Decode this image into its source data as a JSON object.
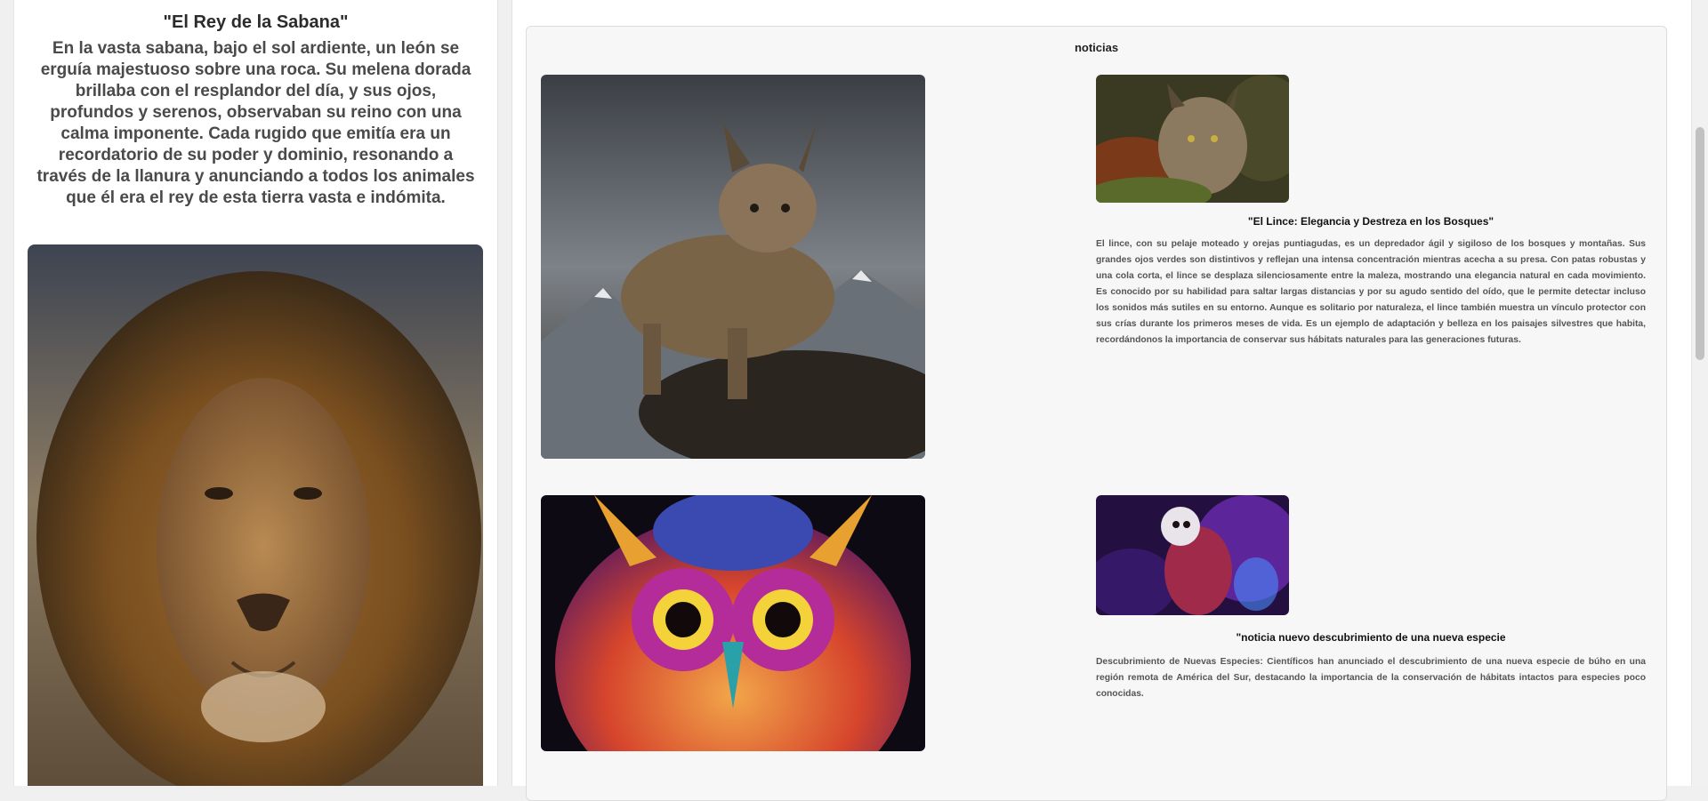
{
  "story": {
    "title": "\"El Rey de la Sabana\"",
    "body": "En la vasta sabana, bajo el sol ardiente, un león se erguía majestuoso sobre una roca. Su melena dorada brillaba con el resplandor del día, y sus ojos, profundos y serenos, observaban su reino con una calma imponente. Cada rugido que emitía era un recordatorio de su poder y dominio, resonando a través de la llanura y anunciando a todos los animales que él era el rey de esta tierra vasta e indómita."
  },
  "news": {
    "heading": "noticias",
    "articles": [
      {
        "title": "\"El Lince: Elegancia y Destreza en los Bosques\"",
        "body": "El lince, con su pelaje moteado y orejas puntiagudas, es un depredador ágil y sigiloso de los bosques y montañas. Sus grandes ojos verdes son distintivos y reflejan una intensa concentración mientras acecha a su presa. Con patas robustas y una cola corta, el lince se desplaza silenciosamente entre la maleza, mostrando una elegancia natural en cada movimiento. Es conocido por su habilidad para saltar largas distancias y por su agudo sentido del oído, que le permite detectar incluso los sonidos más sutiles en su entorno. Aunque es solitario por naturaleza, el lince también muestra un vínculo protector con sus crías durante los primeros meses de vida. Es un ejemplo de adaptación y belleza en los paisajes silvestres que habita, recordándonos la importancia de conservar sus hábitats naturales para las generaciones futuras."
      },
      {
        "title": "\"noticia nuevo descubrimiento de una nueva especie",
        "body": "Descubrimiento de Nuevas Especies: Científicos han anunciado el descubrimiento de una nueva especie de búho en una región remota de América del Sur, destacando la importancia de la conservación de hábitats intactos para especies poco conocidas."
      }
    ]
  },
  "colors": {
    "page_bg": "#f0f0f0",
    "panel_bg": "#f7f7f7",
    "title_text": "#2b2b2b",
    "body_text": "#555555"
  }
}
